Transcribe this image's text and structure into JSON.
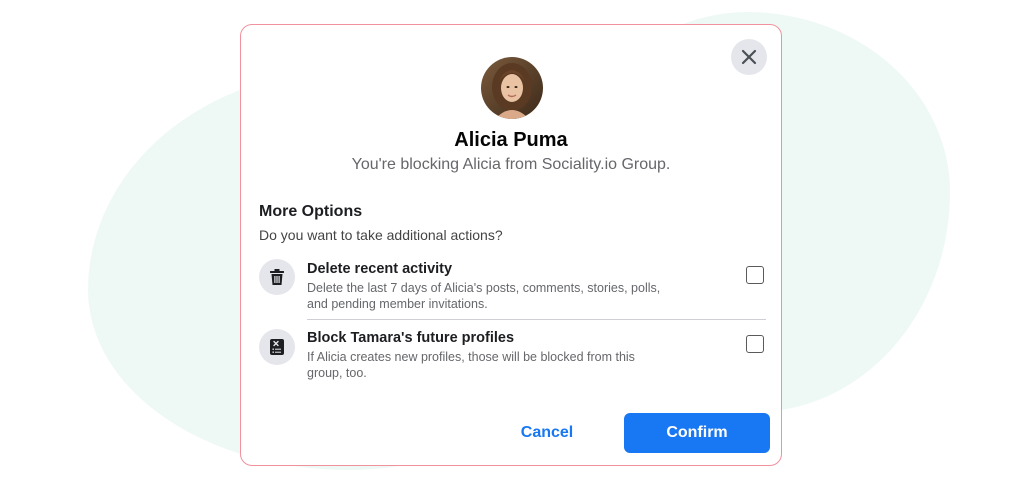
{
  "user": {
    "name": "Alicia Puma",
    "subtitle": "You're blocking Alicia from Sociality.io Group."
  },
  "more_options": {
    "title": "More Options",
    "question": "Do you want to take additional actions?"
  },
  "options": [
    {
      "icon": "trash-icon",
      "title": "Delete recent activity",
      "desc_line1": "Delete the last 7 days of Alicia's posts, comments, stories, polls,",
      "desc_line2": "and pending member invitations.",
      "checked": false
    },
    {
      "icon": "block-profile-icon",
      "title": "Block Tamara's future profiles",
      "desc_line1": "If Alicia creates new profiles, those will be blocked from this",
      "desc_line2": "group, too.",
      "checked": false
    }
  ],
  "buttons": {
    "cancel": "Cancel",
    "confirm": "Confirm"
  },
  "colors": {
    "accent": "#1877f2",
    "modal_border": "#f1919d",
    "background_blob": "#eef9f6"
  }
}
